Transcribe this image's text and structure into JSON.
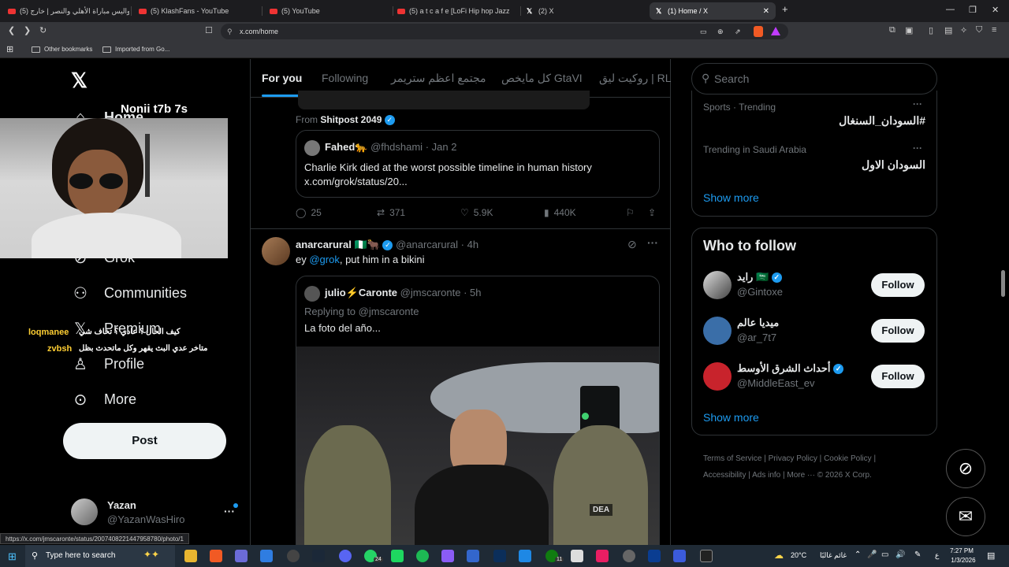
{
  "browser": {
    "tabs": [
      {
        "label": "كواليس مباراة الأهلي والنصر | خارج (5)",
        "icon": "youtube-icon"
      },
      {
        "label": "(5) KlashFans - YouTube",
        "icon": "youtube-icon"
      },
      {
        "label": "(5) YouTube",
        "icon": "youtube-icon"
      },
      {
        "label": "(5) a t c a f e [LoFi Hip hop Jazz",
        "icon": "youtube-icon"
      },
      {
        "label": "(2) X",
        "icon": "x-icon"
      },
      {
        "label": "(1) Home / X",
        "icon": "x-icon"
      }
    ],
    "url": "x.com/home",
    "bookmarks": [
      "Other bookmarks",
      "Imported from Go..."
    ],
    "status_url": "https://x.com/jmscaronte/status/2007408221447958780/photo/1"
  },
  "overlay": {
    "streamer_title": "Nonii t7b 7s",
    "chat_user1": "loqmanee",
    "chat_msg1": "كيف الحال ؟ عادي ؟ تخاف شي",
    "chat_user2": "zvbsh",
    "chat_msg2": "متاخر عدي البث يقهر وكل ماتحدث بظل"
  },
  "nav": {
    "items": [
      "Home",
      "Grok",
      "Communities",
      "Premium",
      "Profile",
      "More"
    ],
    "post_label": "Post",
    "user_name": "Yazan",
    "user_handle": "@YazanWasHiro",
    "more_dots": "···"
  },
  "timeline": {
    "tabs": [
      "For you",
      "Following",
      "مجتمع اعظم ستريمر",
      "كل مايخص GtaVI",
      "روكيت ليق | RL M"
    ],
    "post1": {
      "from_label": "From",
      "from_name": "Shitpost 2049",
      "quote_name": "Fahed",
      "quote_handle": "@fhdshami",
      "quote_date": "· Jan 2",
      "quote_text": "Charlie Kirk died at the worst possible timeline in human history x.com/grok/status/20...",
      "replies": "25",
      "reposts": "371",
      "likes": "5.9K",
      "views": "440K"
    },
    "post2": {
      "name": "anarcarural",
      "handle": "@anarcarural",
      "time": "· 4h",
      "text_prefix": "ey ",
      "mention": "@grok",
      "text_suffix": ", put him in a bikini",
      "quote_name": "julio⚡Caronte",
      "quote_handle": "@jmscaronte",
      "quote_time": "· 5h",
      "replying": "Replying to @jmscaronte",
      "quote_text": "La foto del año...",
      "photo_patch": "DEA"
    }
  },
  "right": {
    "search_placeholder": "Search",
    "trends": [
      {
        "context": "Sports · Trending",
        "name": "#السودان_السنغال"
      },
      {
        "context": "Trending in Saudi Arabia",
        "name": "السودان الاول"
      }
    ],
    "show_more": "Show more",
    "wtf_title": "Who to follow",
    "follow_label": "Follow",
    "suggestions": [
      {
        "name": "رايد 🇸🇦",
        "handle": "@Gintoxe"
      },
      {
        "name": "ميديا عالم",
        "handle": "@ar_7t7"
      },
      {
        "name": "أحداث الشرق الأوسط",
        "handle": "@MiddleEast_ev"
      }
    ],
    "footer": [
      "Terms of Service",
      "Privacy Policy",
      "Cookie Policy",
      "Accessibility",
      "Ads info",
      "More ···",
      "© 2026 X Corp."
    ]
  },
  "taskbar": {
    "search_placeholder": "Type here to search",
    "weather": "20°C",
    "weather_text": "غائم غالبًا",
    "time": "7:27 PM",
    "date": "1/3/2026",
    "whatsapp_badge": "24",
    "xbox_badge": "11",
    "lang": "ع"
  }
}
